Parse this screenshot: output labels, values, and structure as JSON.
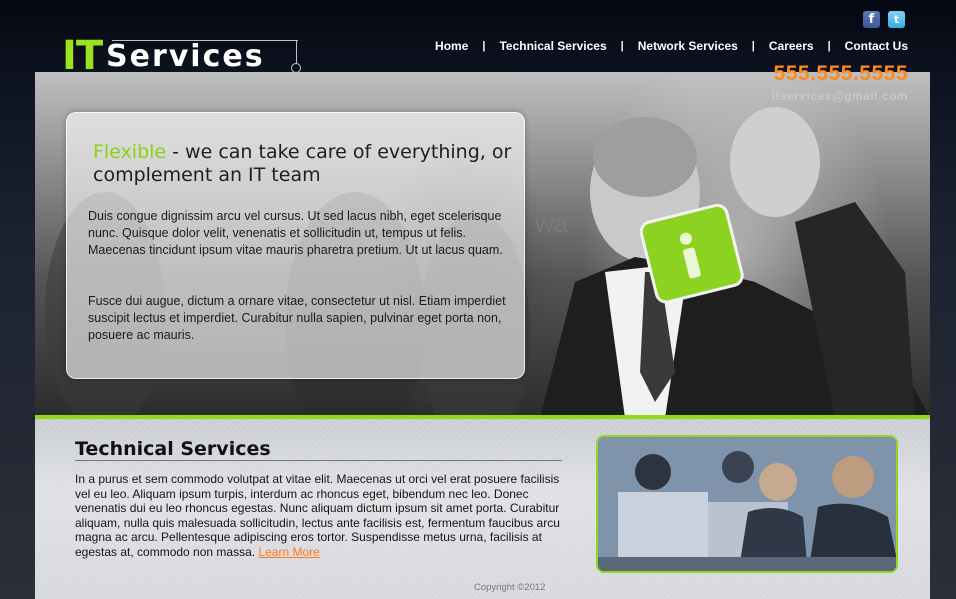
{
  "brand": {
    "logo_it": "IT",
    "logo_services": "Services"
  },
  "social": {
    "facebook_glyph": "f",
    "twitter_glyph": "t",
    "icons": [
      "facebook-icon",
      "twitter-icon"
    ]
  },
  "nav": {
    "items": [
      {
        "label": "Home"
      },
      {
        "label": "Technical Services"
      },
      {
        "label": "Network Services"
      },
      {
        "label": "Careers"
      },
      {
        "label": "Contact Us"
      }
    ],
    "separator": "|"
  },
  "contact": {
    "phone": "555.555.5555",
    "email": "itservices@gmail.com"
  },
  "hero": {
    "headline_accent": "Flexible",
    "headline_rest": " - we can take care of everything, or complement an IT team",
    "paragraphs": [
      "Duis congue dignissim arcu vel cursus. Ut sed lacus nibh, eget scelerisque nunc. Quisque dolor velit, venenatis et sollicitudin ut, tempus ut felis. Maecenas tincidunt ipsum vitae mauris pharetra pretium. Ut ut lacus quam.",
      "Fusce dui augue, dictum a ornare vitae, consectetur ut nisl. Etiam imperdiet suscipit lectus et imperdiet. Curabitur nulla sapien, pulvinar eget porta non, posuere ac mauris."
    ]
  },
  "section": {
    "title": "Technical Services",
    "body": "In a purus et sem commodo volutpat at vitae elit. Maecenas ut orci vel erat posuere facilisis vel eu leo. Aliquam ipsum turpis, interdum ac rhoncus eget, bibendum nec leo. Donec venenatis dui eu leo rhoncus egestas. Nunc aliquam dictum ipsum sit amet porta. Curabitur aliquam, nulla quis malesuada sollicitudin, lectus ante facilisis est, fermentum faucibus arcu magna ac arcu. Pellentesque adipiscing eros tortor. Suspendisse metus urna, facilisis at egestas at, commodo non massa.",
    "link": "Learn More"
  },
  "footer": {
    "copyright": "Copyright ©2012"
  },
  "colors": {
    "accent_green": "#8fd91c",
    "phone_orange": "#ff8a1e",
    "link_orange": "#ff7a1a"
  }
}
